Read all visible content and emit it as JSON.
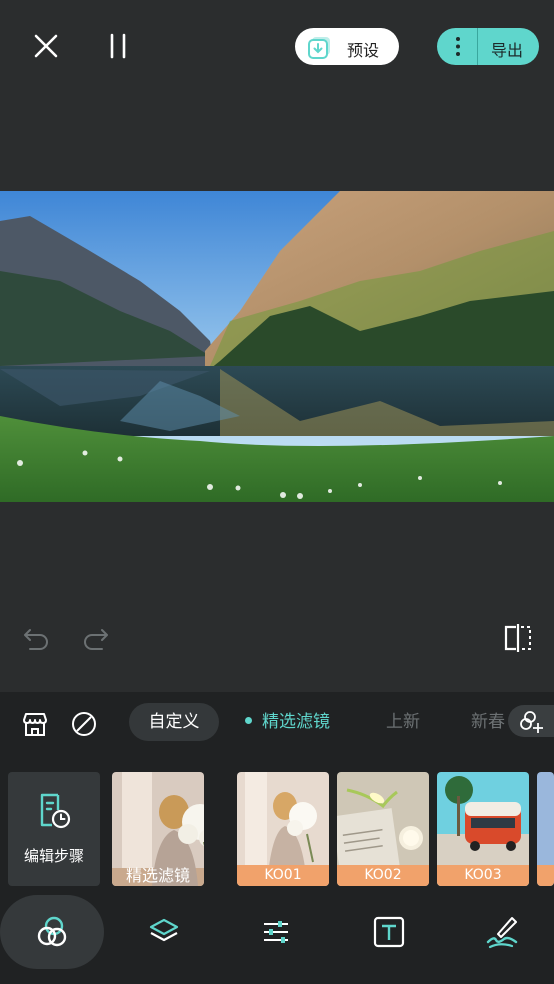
{
  "topbar": {
    "preset_label": "预设",
    "export_label": "导出"
  },
  "colors": {
    "accent": "#5fd6cc",
    "caption_orange": "#f1a26b"
  },
  "filter_tabs": {
    "custom": "自定义",
    "featured": "精选滤镜",
    "new": "上新",
    "spring": "新春"
  },
  "filters": {
    "edit_steps": "编辑步骤",
    "items": [
      {
        "caption": "精选滤镜"
      },
      {
        "caption": "KO01"
      },
      {
        "caption": "KO02"
      },
      {
        "caption": "KO03"
      }
    ]
  },
  "icons": [
    "close-icon",
    "pause-icon",
    "preset-download-icon",
    "more-vertical-icon",
    "undo-icon",
    "redo-icon",
    "compare-icon",
    "store-icon",
    "no-filter-icon",
    "add-filter-icon",
    "edit-steps-icon",
    "filter-icon",
    "layers-icon",
    "adjust-icon",
    "text-icon",
    "brush-icon"
  ]
}
